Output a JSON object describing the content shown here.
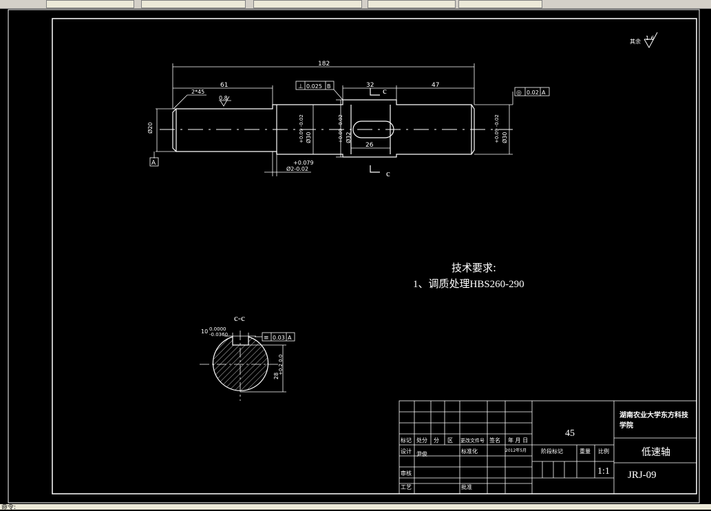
{
  "window": {
    "status_text": "命令:"
  },
  "drawing": {
    "roughness_other": {
      "label": "其余",
      "value": "1.6"
    },
    "roughness_face": "0.8",
    "datum_a": "A",
    "shaft": {
      "overall_length": "182",
      "left_segment_length": "61",
      "key_section_length": "32",
      "right_segment_length": "47",
      "keyway_length": "26",
      "chamfer": "2*45",
      "left_diameter": "Ø20",
      "diameter_mid": "Ø30",
      "diameter_mid_tol": "+0.09 -0.02",
      "diameter_key": "Ø32",
      "diameter_key_tol": "+0.09 -0.02",
      "diameter_right": "Ø30",
      "diameter_right_tol": "+0.09 -0.02",
      "shoulder_tol_upper": "+0.079",
      "shoulder_tol_lower": "Ø2-0.02"
    },
    "geo_tolerances": {
      "perpendicular": {
        "symbol": "⊥",
        "value": "0.025",
        "datum": "B"
      },
      "runout": {
        "symbol": "◎",
        "value": "0.02",
        "datum": "A"
      },
      "symmetry": {
        "symbol": "≡",
        "value": "0.03",
        "datum": "A"
      }
    },
    "section_marker": "c",
    "section_title": "c-c",
    "section": {
      "key_width": "10",
      "key_tol_upper": "0.0000",
      "key_tol_lower": "-0.0360",
      "depth_dim": "28",
      "depth_tol": "+0.2 0.0"
    },
    "tech_requirements": {
      "title": "技术要求:",
      "item1": "1、调质处理HBS260-290"
    }
  },
  "title_block": {
    "material": "45",
    "school": "湖南农业大学东方科技学院",
    "part_name": "低速轴",
    "drawing_no": "JRJ-09",
    "scale": "1:1",
    "scale_label": "比例",
    "weight_label": "重量",
    "stage_label": "阶段标记",
    "row_headers": [
      "标记",
      "处分",
      "分",
      "区",
      "更改文件号",
      "签名",
      "年 月 日"
    ],
    "designer_label": "设计",
    "designer": "尹俊",
    "standard_label": "标准化",
    "date": "2012年5月",
    "review_label": "审核",
    "process_label": "工艺",
    "approve_label": "批准"
  }
}
